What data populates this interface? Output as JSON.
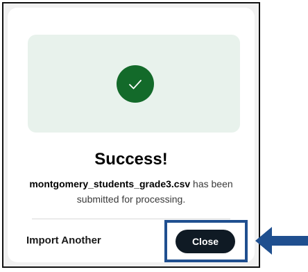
{
  "dialog": {
    "title": "Success!",
    "file_name": "montgomery_students_grade3.csv",
    "message_suffix": " has been submitted for processing.",
    "status_icon": "check-icon",
    "colors": {
      "check_circle": "#136a2a",
      "hero_background": "#e8f2ec",
      "primary_button": "#0f1a24"
    }
  },
  "actions": {
    "import_another_label": "Import Another",
    "close_label": "Close"
  },
  "annotation": {
    "highlight_color": "#1f4f8f",
    "arrow_color": "#1f4f8f",
    "arrow_icon": "left-arrow-icon"
  }
}
